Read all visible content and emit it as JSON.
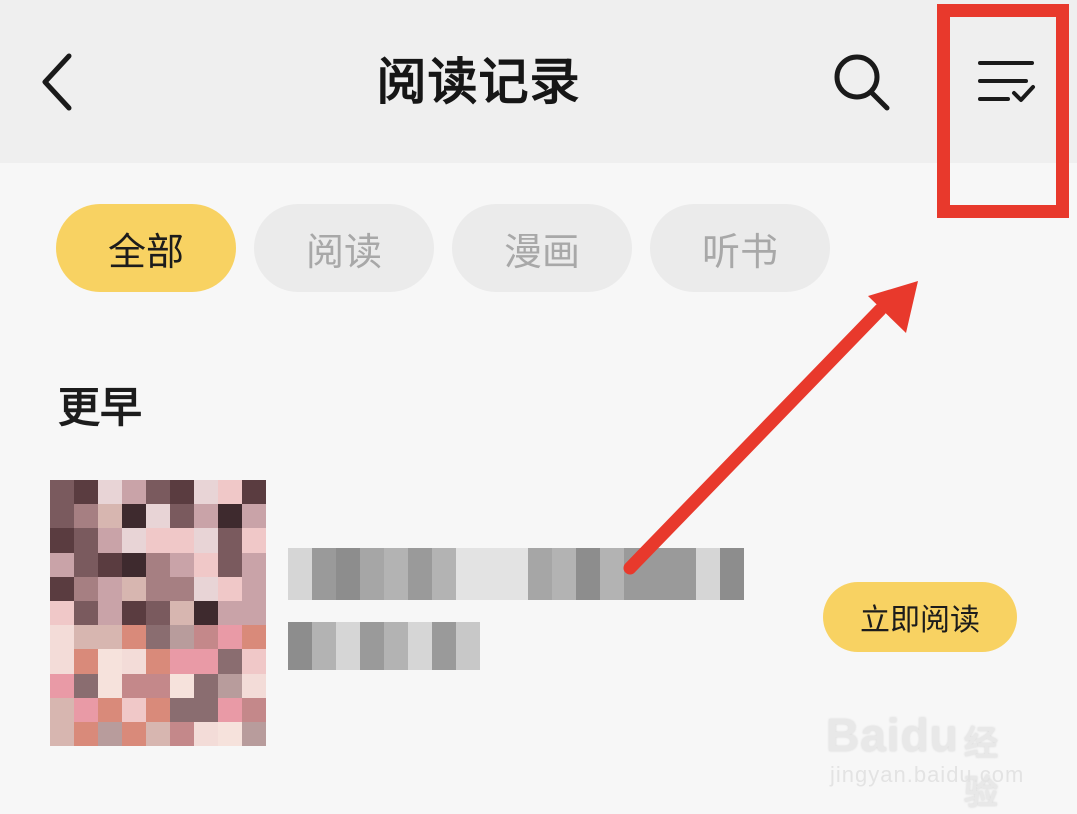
{
  "header": {
    "title": "阅读记录",
    "back_icon": "chevron-left-icon",
    "search_icon": "search-icon",
    "manage_icon": "list-check-icon"
  },
  "tabs": [
    {
      "label": "全部",
      "active": true
    },
    {
      "label": "阅读",
      "active": false
    },
    {
      "label": "漫画",
      "active": false
    },
    {
      "label": "听书",
      "active": false
    }
  ],
  "section": {
    "title": "更早"
  },
  "book": {
    "read_button_label": "立即阅读"
  },
  "watermark": {
    "brand": "Baidu",
    "suffix": "经验",
    "domain": "jingyan.baidu.com"
  },
  "colors": {
    "accent_yellow": "#f8d262",
    "annotation_red": "#e8392c",
    "header_bg": "#efefef",
    "page_bg": "#f7f7f7"
  }
}
